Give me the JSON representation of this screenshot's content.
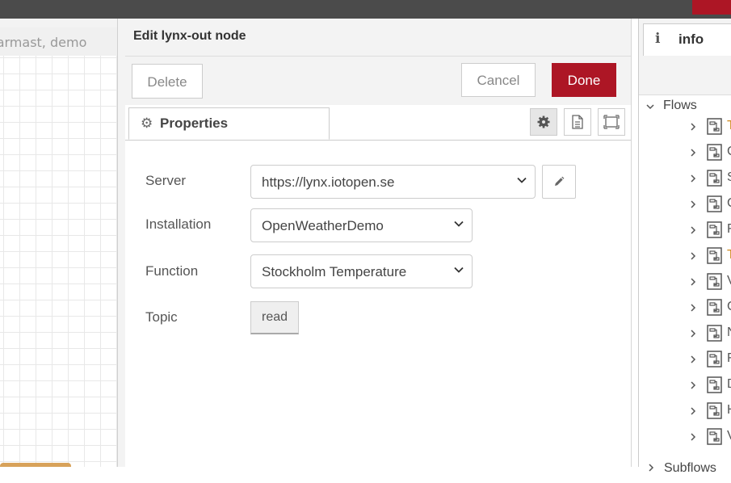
{
  "workspace": {
    "tab_label": "Varmast, demo"
  },
  "editor": {
    "title": "Edit lynx-out node",
    "delete_label": "Delete",
    "cancel_label": "Cancel",
    "done_label": "Done",
    "tab_properties": "Properties",
    "server_label": "Server",
    "server_value": "https://lynx.iotopen.se",
    "installation_label": "Installation",
    "installation_value": "OpenWeatherDemo",
    "function_label": "Function",
    "function_value": "Stockholm Temperature",
    "topic_label": "Topic",
    "topic_value": "read"
  },
  "sidebar": {
    "tab_label": "info",
    "flows_label": "Flows",
    "subflows_label": "Subflows",
    "flows": [
      {
        "letter": "T",
        "color": "#d08a1c"
      },
      {
        "letter": "C",
        "color": "#555555"
      },
      {
        "letter": "S",
        "color": "#555555"
      },
      {
        "letter": "C",
        "color": "#555555"
      },
      {
        "letter": "F",
        "color": "#555555"
      },
      {
        "letter": "T",
        "color": "#d08a1c"
      },
      {
        "letter": "V",
        "color": "#555555"
      },
      {
        "letter": "C",
        "color": "#555555"
      },
      {
        "letter": "N",
        "color": "#555555"
      },
      {
        "letter": "F",
        "color": "#555555"
      },
      {
        "letter": "D",
        "color": "#555555"
      },
      {
        "letter": "H",
        "color": "#555555"
      },
      {
        "letter": "V",
        "color": "#555555"
      }
    ]
  },
  "colors": {
    "accent": "#ad1625",
    "topbar": "#4b4b4b"
  }
}
